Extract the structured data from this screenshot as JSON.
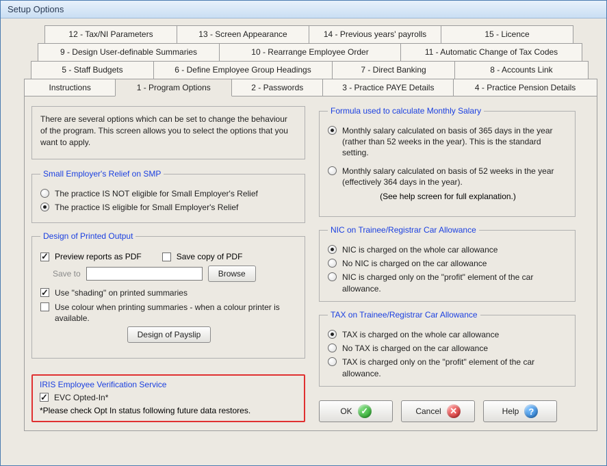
{
  "window_title": "Setup Options",
  "tabs": {
    "row1": [
      "12 - Tax/NI Parameters",
      "13 - Screen Appearance",
      "14 - Previous years' payrolls",
      "15 - Licence"
    ],
    "row2": [
      "9 - Design User-definable Summaries",
      "10 - Rearrange Employee Order",
      "11 - Automatic Change of Tax Codes"
    ],
    "row3": [
      "5 - Staff  Budgets",
      "6 - Define Employee Group Headings",
      "7 - Direct Banking",
      "8 - Accounts Link"
    ],
    "row4": [
      "Instructions",
      "1 - Program Options",
      "2 - Passwords",
      "3 - Practice PAYE Details",
      "4 - Practice Pension Details"
    ]
  },
  "active_tab": "1 - Program Options",
  "intro_text": "There are several options which can be set to change the behaviour of the program.  This screen allows you to select the options that you want to apply.",
  "smp": {
    "legend": "Small Employer's Relief on SMP",
    "opt_not_eligible": "The practice IS NOT eligible for Small Employer's Relief",
    "opt_eligible": "The practice IS eligible for Small Employer's Relief",
    "selected": "eligible"
  },
  "printed": {
    "legend": "Design of Printed Output",
    "preview_pdf": "Preview reports as PDF",
    "preview_pdf_on": true,
    "save_copy_pdf": "Save copy of PDF",
    "save_copy_pdf_on": false,
    "save_to_label": "Save to",
    "save_to_value": "",
    "browse": "Browse",
    "shading": "Use \"shading\" on printed summaries",
    "shading_on": true,
    "colour": "Use colour when printing summaries - when a colour printer is available.",
    "colour_on": false,
    "design_payslip": "Design of Payslip"
  },
  "evc": {
    "legend": "IRIS Employee Verification Service",
    "opted_in": "EVC Opted-In*",
    "opted_in_on": true,
    "note": "*Please check Opt In status following future data restores."
  },
  "monthly_salary": {
    "legend": "Formula used to calculate Monthly Salary",
    "opt365": "Monthly salary calculated on basis of 365 days in the year (rather than 52 weeks in the year).  This is the standard setting.",
    "opt52": "Monthly salary calculated on basis of 52 weeks in the year (effectively 364 days in the year).",
    "selected": "365",
    "help_note": "(See help screen for full explanation.)"
  },
  "nic": {
    "legend": "NIC on Trainee/Registrar  Car Allowance",
    "opt_whole": "NIC is charged on the whole car allowance",
    "opt_none": "No NIC is charged on the car allowance",
    "opt_profit": "NIC is charged only on the \"profit\" element of the car allowance.",
    "selected": "whole"
  },
  "tax": {
    "legend": "TAX on Trainee/Registrar  Car Allowance",
    "opt_whole": "TAX is charged on the whole car allowance",
    "opt_none": "No TAX is charged on the car allowance",
    "opt_profit": "TAX is charged only on the \"profit\" element of the car allowance.",
    "selected": "whole"
  },
  "buttons": {
    "ok": "OK",
    "cancel": "Cancel",
    "help": "Help"
  }
}
